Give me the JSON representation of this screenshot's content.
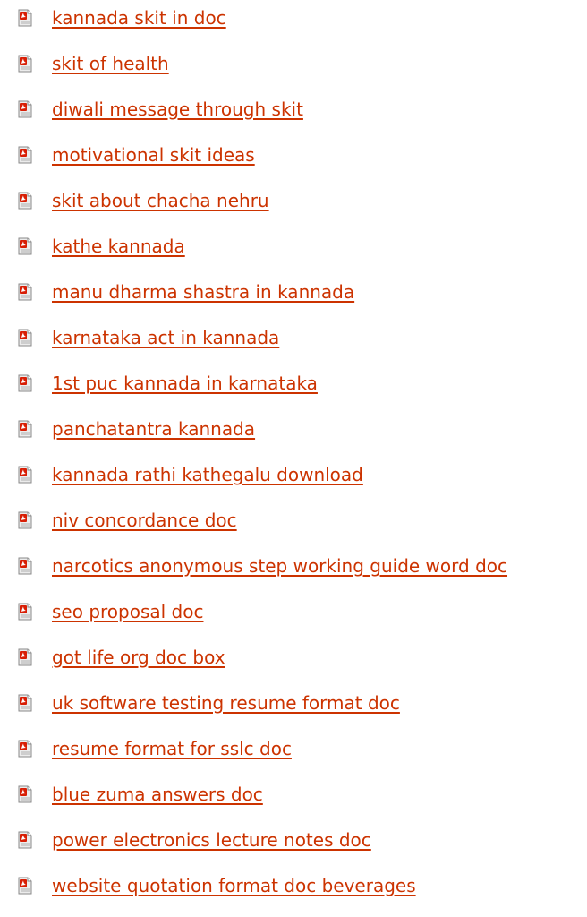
{
  "colors": {
    "link": "#cc3300",
    "icon_red": "#d81e05",
    "icon_page": "#e8e8e8"
  },
  "icons": {
    "document": "pdf-document-icon"
  },
  "links": [
    {
      "label": "kannada skit in doc"
    },
    {
      "label": "skit of health"
    },
    {
      "label": "diwali message through skit"
    },
    {
      "label": "motivational skit ideas"
    },
    {
      "label": "skit about chacha nehru"
    },
    {
      "label": "kathe kannada"
    },
    {
      "label": "manu dharma shastra in kannada"
    },
    {
      "label": "karnataka act in kannada"
    },
    {
      "label": "1st puc kannada in karnataka"
    },
    {
      "label": "panchatantra kannada"
    },
    {
      "label": "kannada rathi kathegalu download"
    },
    {
      "label": "niv concordance doc"
    },
    {
      "label": "narcotics anonymous step working guide word doc"
    },
    {
      "label": "seo proposal doc"
    },
    {
      "label": "got life org doc box"
    },
    {
      "label": "uk software testing resume format doc"
    },
    {
      "label": "resume format for sslc doc"
    },
    {
      "label": "blue zuma answers doc"
    },
    {
      "label": "power electronics lecture notes doc"
    },
    {
      "label": "website quotation format doc beverages"
    }
  ]
}
